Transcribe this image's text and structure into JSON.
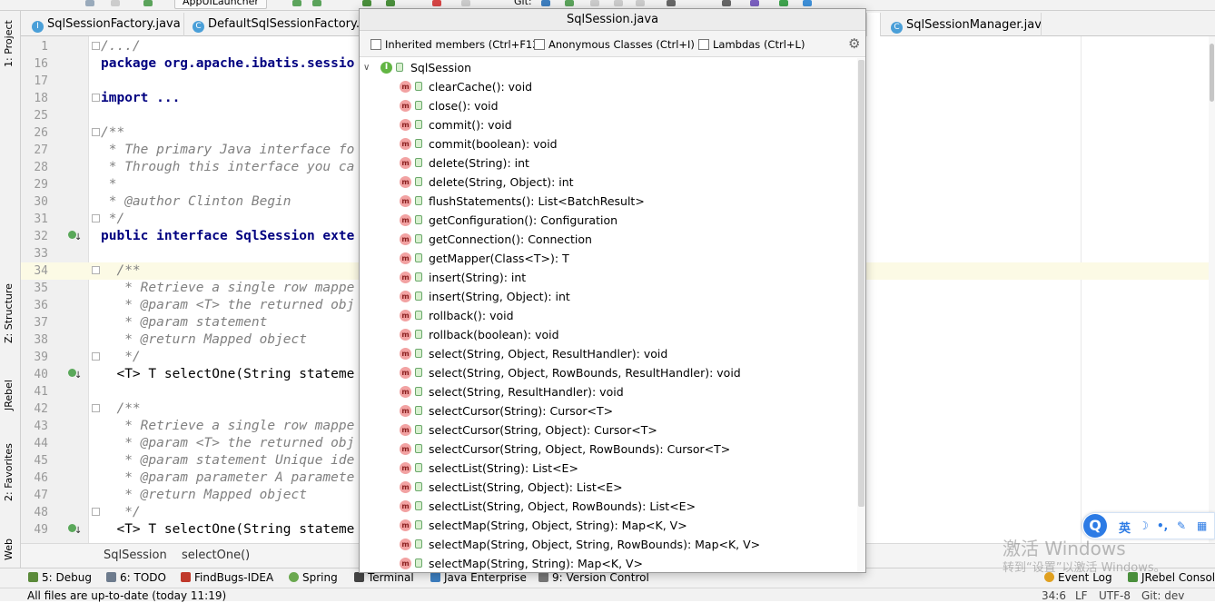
{
  "toolbar": {
    "run_config": "AppUILauncher",
    "git_label": "Git:"
  },
  "left_strip": {
    "project": "1: Project",
    "structure": "Z: Structure",
    "jrebel": "JRebel",
    "favorites": "2: Favorites",
    "web": "Web"
  },
  "tabs": [
    {
      "label": "SqlSessionFactory.java",
      "icon": "class-icon"
    },
    {
      "label": "DefaultSqlSessionFactory.java",
      "icon": "class-icon"
    },
    {
      "label": "SqlSessionManager.java",
      "icon": "class-icon"
    }
  ],
  "editor": {
    "lines": [
      {
        "n": "1",
        "t": "/.../",
        "style": "cmt",
        "fold": true
      },
      {
        "n": "16",
        "t": "package org.apache.ibatis.sessio",
        "style": "kw"
      },
      {
        "n": "17",
        "t": ""
      },
      {
        "n": "18",
        "t": "import ...",
        "style": "kw",
        "fold": true
      },
      {
        "n": "25",
        "t": ""
      },
      {
        "n": "26",
        "t": "/**",
        "style": "cmt",
        "fold": true
      },
      {
        "n": "27",
        "t": " * The primary Java interface fo",
        "style": "cmt"
      },
      {
        "n": "28",
        "t": " * Through this interface you ca",
        "style": "cmt"
      },
      {
        "n": "29",
        "t": " *",
        "style": "cmt"
      },
      {
        "n": "30",
        "t": " * @author Clinton Begin",
        "style": "cmt"
      },
      {
        "n": "31",
        "t": " */",
        "style": "cmt",
        "fold": true
      },
      {
        "n": "32",
        "t": "public interface SqlSession exte",
        "style": "kw",
        "mark": true
      },
      {
        "n": "33",
        "t": ""
      },
      {
        "n": "34",
        "t": "  /**",
        "style": "cmt",
        "fold": true,
        "hl": true
      },
      {
        "n": "35",
        "t": "   * Retrieve a single row mappe",
        "style": "cmt"
      },
      {
        "n": "36",
        "t": "   * @param <T> the returned obj",
        "style": "cmt"
      },
      {
        "n": "37",
        "t": "   * @param statement",
        "style": "cmt"
      },
      {
        "n": "38",
        "t": "   * @return Mapped object",
        "style": "cmt"
      },
      {
        "n": "39",
        "t": "   */",
        "style": "cmt",
        "fold": true
      },
      {
        "n": "40",
        "t": "  <T> T selectOne(String stateme",
        "style": "",
        "mark": true
      },
      {
        "n": "41",
        "t": ""
      },
      {
        "n": "42",
        "t": "  /**",
        "style": "cmt",
        "fold": true
      },
      {
        "n": "43",
        "t": "   * Retrieve a single row mappe",
        "style": "cmt"
      },
      {
        "n": "44",
        "t": "   * @param <T> the returned obj",
        "style": "cmt"
      },
      {
        "n": "45",
        "t": "   * @param statement Unique ide",
        "style": "cmt"
      },
      {
        "n": "46",
        "t": "   * @param parameter A paramete",
        "style": "cmt"
      },
      {
        "n": "47",
        "t": "   * @return Mapped object",
        "style": "cmt"
      },
      {
        "n": "48",
        "t": "   */",
        "style": "cmt",
        "fold": true
      },
      {
        "n": "49",
        "t": "  <T> T selectOne(String stateme",
        "style": "",
        "mark": true
      }
    ]
  },
  "breadcrumb": {
    "item1": "SqlSession",
    "item2": "selectOne()"
  },
  "popup": {
    "title": "SqlSession.java",
    "filters": [
      "Inherited members (Ctrl+F12)",
      "Anonymous Classes (Ctrl+I)",
      "Lambdas (Ctrl+L)"
    ],
    "root": "SqlSession",
    "members": [
      "clearCache(): void",
      "close(): void",
      "commit(): void",
      "commit(boolean): void",
      "delete(String): int",
      "delete(String, Object): int",
      "flushStatements(): List<BatchResult>",
      "getConfiguration(): Configuration",
      "getConnection(): Connection",
      "getMapper(Class<T>): T",
      "insert(String): int",
      "insert(String, Object): int",
      "rollback(): void",
      "rollback(boolean): void",
      "select(String, Object, ResultHandler): void",
      "select(String, Object, RowBounds, ResultHandler): void",
      "select(String, ResultHandler): void",
      "selectCursor(String): Cursor<T>",
      "selectCursor(String, Object): Cursor<T>",
      "selectCursor(String, Object, RowBounds): Cursor<T>",
      "selectList(String): List<E>",
      "selectList(String, Object): List<E>",
      "selectList(String, Object, RowBounds): List<E>",
      "selectMap(String, Object, String): Map<K, V>",
      "selectMap(String, Object, String, RowBounds): Map<K, V>",
      "selectMap(String, String): Map<K, V>"
    ]
  },
  "toolwindows": [
    {
      "label": "5: Debug",
      "color": "#5b8a3a"
    },
    {
      "label": "6: TODO",
      "color": "#6d7b8d"
    },
    {
      "label": "FindBugs-IDEA",
      "color": "#c0392b"
    },
    {
      "label": "Spring",
      "color": "#6aa84f"
    },
    {
      "label": "Terminal",
      "color": "#444444"
    },
    {
      "label": "Java Enterprise",
      "color": "#3d7ebf"
    },
    {
      "label": "9: Version Control",
      "color": "#777777"
    },
    {
      "label": "Event Log",
      "color": "#e0a020"
    },
    {
      "label": "JRebel Console",
      "color": "#4a8f3c"
    }
  ],
  "status": {
    "message": "All files are up-to-date (today 11:19)",
    "position": "34:6",
    "line_sep": "LF",
    "encoding": "UTF-8",
    "git": "Git: dev"
  },
  "watermark": {
    "line1": "激活 Windows",
    "line2": "转到“设置”以激活 Windows。"
  },
  "ime": {
    "badge": "Q",
    "mode": "英"
  },
  "colors": {
    "accent": "#2c7be5",
    "method_icon": "#f2a2a2",
    "interface_icon": "#62b543"
  }
}
